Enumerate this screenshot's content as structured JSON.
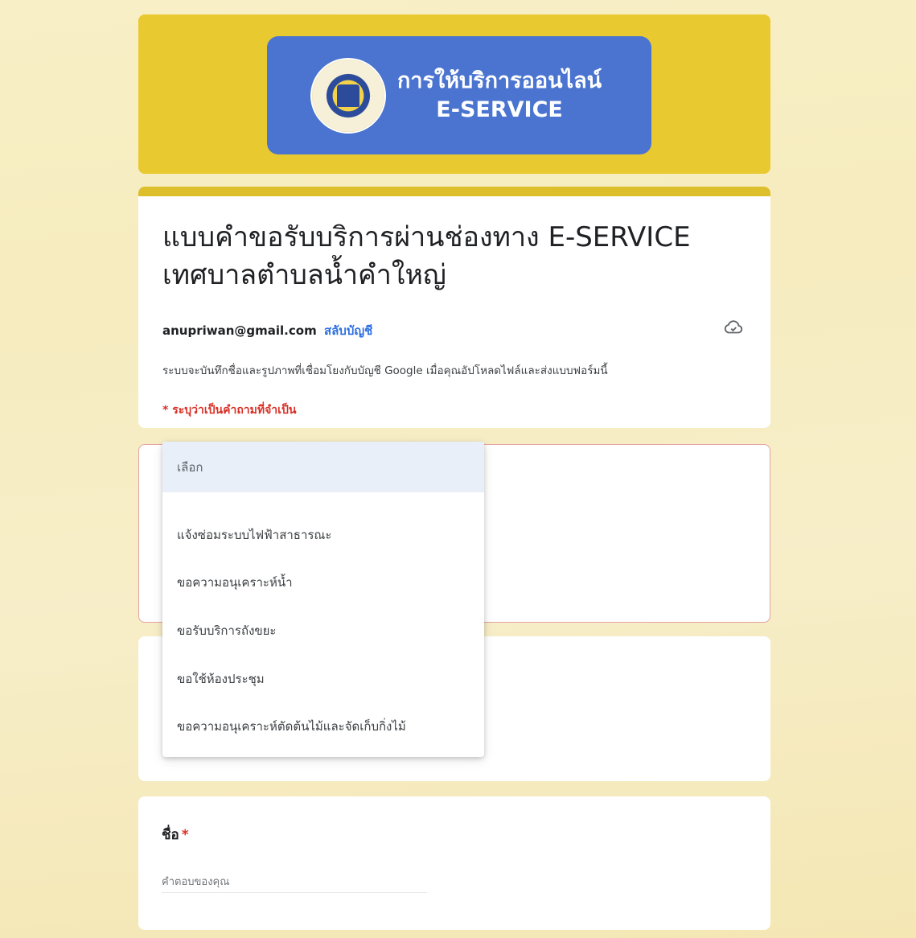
{
  "banner": {
    "line1": "การให้บริการออนไลน์",
    "line2": "E-SERVICE"
  },
  "form": {
    "title": "แบบคำขอรับบริการผ่านช่องทาง E-SERVICE เทศบาลตำบลน้ำคำใหญ่",
    "account_email": "anupriwan@gmail.com",
    "switch_account": "สลับบัญชี",
    "notice": "ระบบจะบันทึกชื่อและรูปภาพที่เชื่อมโยงกับบัญชี Google เมื่อคุณอัปโหลดไฟล์และส่งแบบฟอร์มนี้",
    "required_note": "* ระบุว่าเป็นคำถามที่จำเป็น"
  },
  "dropdown": {
    "selected": "เลือก",
    "options": [
      "แจ้งซ่อมระบบไฟฟ้าสาธารณะ",
      "ขอความอนุเคราะห์น้ำ",
      "ขอรับบริการถังขยะ",
      "ขอใช้ห้องประชุม",
      "ขอความอนุเคราะห์ตัดต้นไม้และจัดเก็บกิ่งไม้"
    ]
  },
  "name_question": {
    "label": "ชื่อ",
    "required_mark": "*",
    "placeholder": "คำตอบของคุณ"
  },
  "colors": {
    "banner_yellow": "#e9c930",
    "banner_blue": "#4a74cf",
    "link": "#2d6fe0",
    "required": "#d93025"
  }
}
